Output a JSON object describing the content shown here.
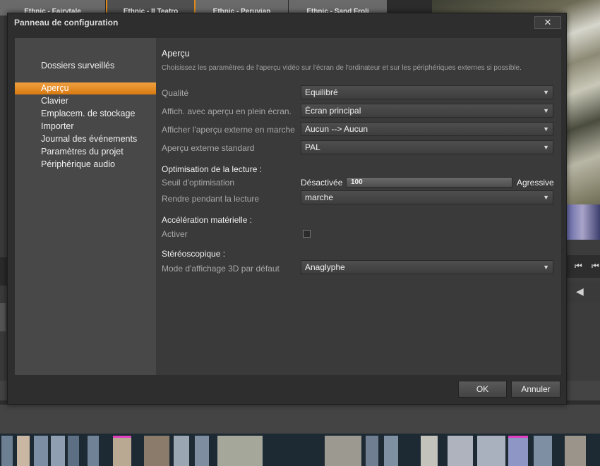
{
  "background": {
    "template_tabs": [
      "Ethnic - Fairytale",
      "Ethnic - Il Teatro",
      "Ethnic - Peruvian",
      "Ethnic - Sand Froli"
    ],
    "active_tab_index": 1,
    "accent_color": "#e08a1a"
  },
  "dialog": {
    "title": "Panneau de configuration",
    "close_icon": "close-icon",
    "close_glyph": "✕"
  },
  "nav": {
    "items": [
      {
        "label": "Dossiers surveillés",
        "active": false
      },
      {
        "label": "Aperçu",
        "active": true
      },
      {
        "label": "Clavier",
        "active": false
      },
      {
        "label": "Emplacem. de stockage",
        "active": false
      },
      {
        "label": "Importer",
        "active": false
      },
      {
        "label": "Journal des événements",
        "active": false
      },
      {
        "label": "Paramètres du projet",
        "active": false
      },
      {
        "label": "Périphérique audio",
        "active": false
      }
    ]
  },
  "content": {
    "title": "Aperçu",
    "description": "Choisissez les paramètres de l'aperçu vidéo sur l'écran de l'ordinateur et sur les périphériques externes si possible.",
    "rows": [
      {
        "label": "Qualité",
        "value": "Equilibré"
      },
      {
        "label": "Affich. avec aperçu en plein écran.",
        "value": "Écran principal"
      },
      {
        "label": "Afficher l'aperçu externe en marche",
        "value": "Aucun --> Aucun"
      },
      {
        "label": "Aperçu externe standard",
        "value": "PAL"
      }
    ],
    "playback_section": "Optimisation de la lecture :",
    "threshold": {
      "label": "Seuil d'optimisation",
      "min_label": "Désactivée",
      "max_label": "Agressive",
      "value": "100",
      "fraction": 1.0
    },
    "render_during_playback": {
      "label": "Rendre pendant la lecture",
      "value": "marche"
    },
    "hw_section": "Accélération matérielle :",
    "activate": {
      "label": "Activer",
      "checked": false
    },
    "stereo_section": "Stéréoscopique :",
    "mode3d": {
      "label": "Mode d'affichage 3D par défaut",
      "value": "Anaglyphe"
    },
    "dropdown_arrow": "▼"
  },
  "buttons": {
    "ok": "OK",
    "cancel": "Annuler"
  }
}
